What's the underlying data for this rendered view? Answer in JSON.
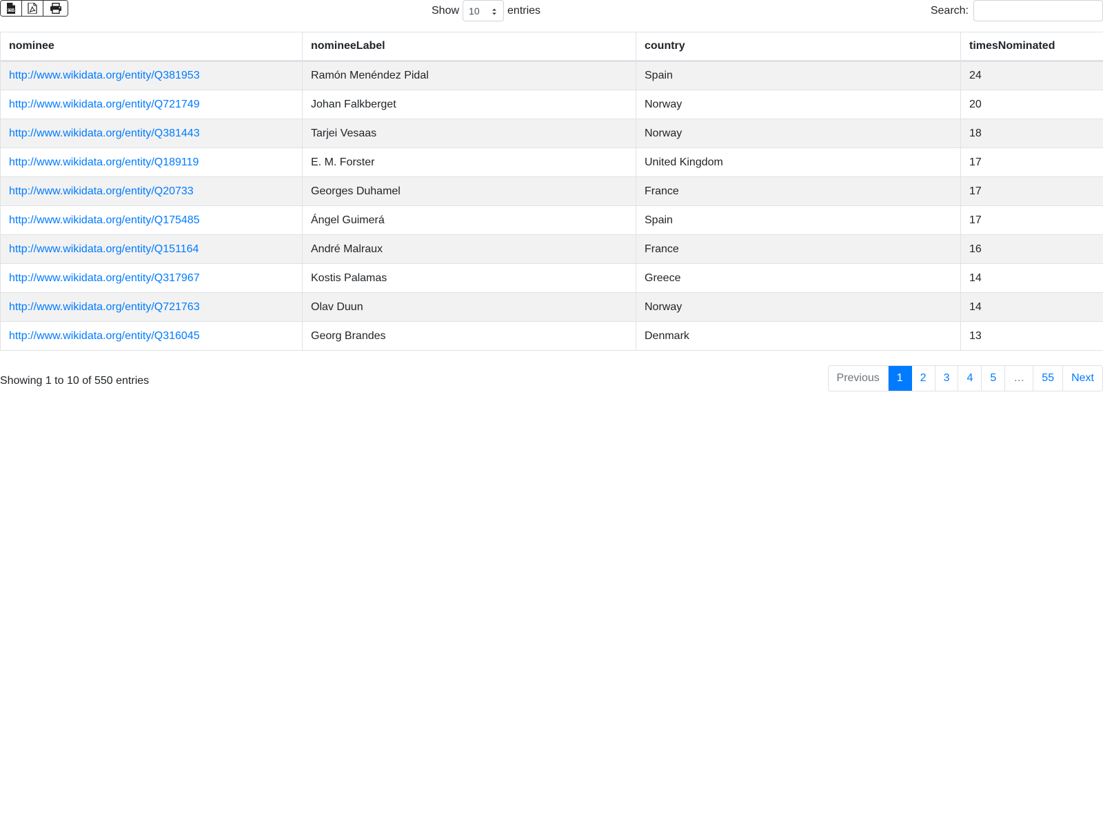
{
  "toolbar": {
    "export_buttons": [
      {
        "icon": "csv-file-icon"
      },
      {
        "icon": "pdf-file-icon"
      },
      {
        "icon": "print-icon"
      }
    ]
  },
  "length": {
    "show_label": "Show",
    "selected": "10",
    "entries_label": "entries"
  },
  "search": {
    "label": "Search:",
    "value": "",
    "placeholder": ""
  },
  "table": {
    "columns": [
      "nominee",
      "nomineeLabel",
      "country",
      "timesNominated"
    ],
    "rows": [
      {
        "nominee": "http://www.wikidata.org/entity/Q381953",
        "label": "Ramón Menéndez Pidal",
        "country": "Spain",
        "times": "24"
      },
      {
        "nominee": "http://www.wikidata.org/entity/Q721749",
        "label": "Johan Falkberget",
        "country": "Norway",
        "times": "20"
      },
      {
        "nominee": "http://www.wikidata.org/entity/Q381443",
        "label": "Tarjei Vesaas",
        "country": "Norway",
        "times": "18"
      },
      {
        "nominee": "http://www.wikidata.org/entity/Q189119",
        "label": "E. M. Forster",
        "country": "United Kingdom",
        "times": "17"
      },
      {
        "nominee": "http://www.wikidata.org/entity/Q20733",
        "label": "Georges Duhamel",
        "country": "France",
        "times": "17"
      },
      {
        "nominee": "http://www.wikidata.org/entity/Q175485",
        "label": "Ángel Guimerá",
        "country": "Spain",
        "times": "17"
      },
      {
        "nominee": "http://www.wikidata.org/entity/Q151164",
        "label": "André Malraux",
        "country": "France",
        "times": "16"
      },
      {
        "nominee": "http://www.wikidata.org/entity/Q317967",
        "label": "Kostis Palamas",
        "country": "Greece",
        "times": "14"
      },
      {
        "nominee": "http://www.wikidata.org/entity/Q721763",
        "label": "Olav Duun",
        "country": "Norway",
        "times": "14"
      },
      {
        "nominee": "http://www.wikidata.org/entity/Q316045",
        "label": "Georg Brandes",
        "country": "Denmark",
        "times": "13"
      }
    ]
  },
  "footer": {
    "info": "Showing 1 to 10 of 550 entries",
    "pagination": {
      "previous": "Previous",
      "pages": [
        "1",
        "2",
        "3",
        "4",
        "5"
      ],
      "ellipsis": "…",
      "last": "55",
      "next": "Next",
      "active": "1"
    }
  },
  "colors": {
    "accent": "#007bff",
    "stripe": "#f2f2f2",
    "border": "#dee2e6"
  }
}
